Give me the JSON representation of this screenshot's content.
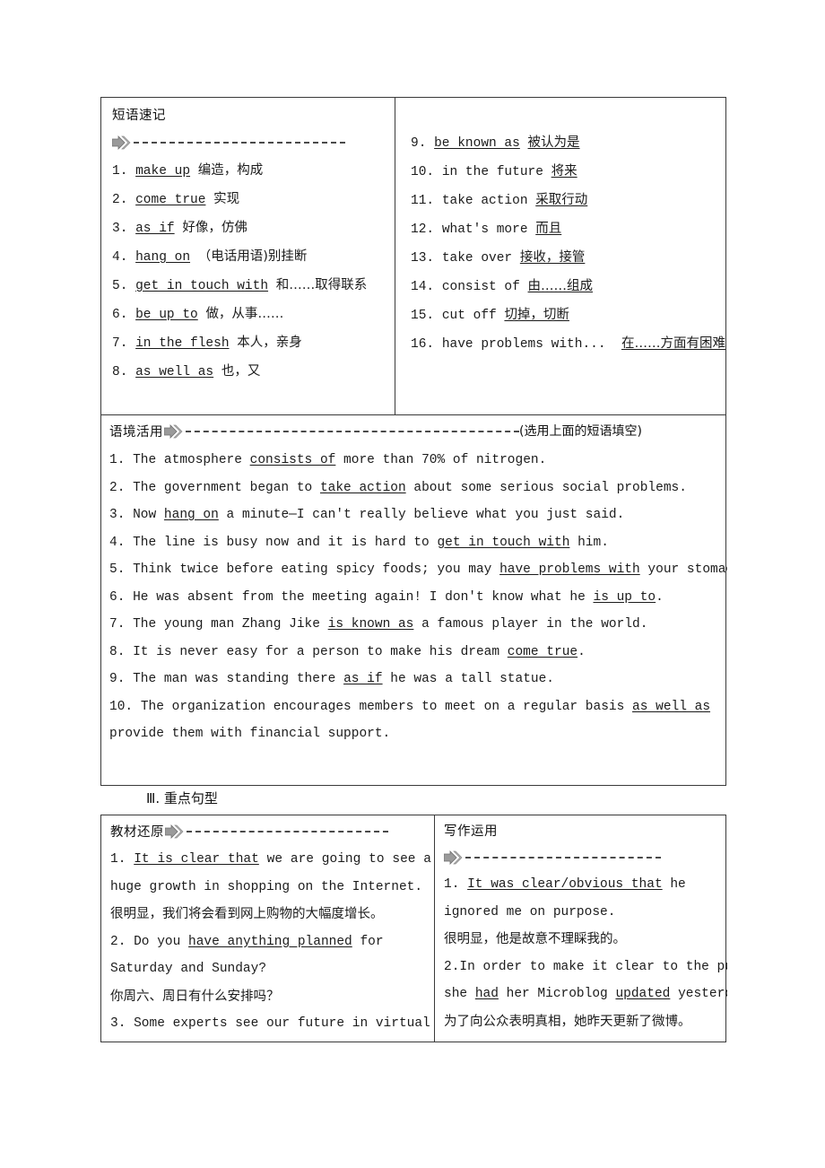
{
  "phrase_box": {
    "title": "短语速记",
    "arrow_icon": "double-chevron-arrow-icon",
    "left_items": [
      {
        "num": "1.",
        "phrase": "make up",
        "meaning": "编造，构成"
      },
      {
        "num": "2.",
        "phrase": "come true",
        "meaning": "实现"
      },
      {
        "num": "3.",
        "phrase": "as if",
        "meaning": "好像，仿佛"
      },
      {
        "num": "4.",
        "phrase": "hang on",
        "meaning": "（电话用语)别挂断"
      },
      {
        "num": "5.",
        "phrase": "get in touch with",
        "meaning": "和……取得联系"
      },
      {
        "num": "6.",
        "phrase": "be up to",
        "meaning": "做，从事……"
      },
      {
        "num": "7.",
        "phrase": "in the flesh",
        "meaning": "本人，亲身"
      },
      {
        "num": "8.",
        "phrase": "as well as",
        "meaning": "也，又"
      }
    ],
    "right_items": [
      {
        "num": "9.",
        "phrase": "be known as",
        "meaning": "被认为是"
      },
      {
        "num": "10.",
        "phrase": "in the future",
        "meaning": "将来"
      },
      {
        "num": "11.",
        "phrase": "take action",
        "meaning": "采取行动"
      },
      {
        "num": "12.",
        "phrase": "what's more",
        "meaning": "而且"
      },
      {
        "num": "13.",
        "phrase": "take over",
        "meaning": "接收，接管"
      },
      {
        "num": "14.",
        "phrase": "consist of",
        "meaning": "由……组成"
      },
      {
        "num": "15.",
        "phrase": "cut off",
        "meaning": "切掉，切断"
      },
      {
        "num": "16.",
        "phrase": "have problems with...",
        "meaning": "在……方面有困难"
      }
    ]
  },
  "context_box": {
    "title": "语境活用",
    "arrow_icon": "double-chevron-arrow-icon",
    "hint": "(选用上面的短语填空)",
    "sentences": [
      {
        "num": "1.",
        "pre": "The atmosphere ",
        "answer": "consists of",
        "post": " more than 70% of nitrogen."
      },
      {
        "num": "2.",
        "pre": "The government began to ",
        "answer": "take action",
        "post": " about some serious social problems."
      },
      {
        "num": "3.",
        "pre": "Now ",
        "answer": "hang on",
        "post": " a minute—I can't really believe what you just said."
      },
      {
        "num": "4.",
        "pre": "The line is busy now and it is hard to ",
        "answer": "get in touch with",
        "post": " him."
      },
      {
        "num": "5.",
        "pre": "Think twice before eating spicy foods; you may ",
        "answer": "have problems with",
        "post": " your stomach."
      },
      {
        "num": "6.",
        "pre": "He was absent from the meeting again! I don't know what he ",
        "answer": "is up to",
        "post": "."
      },
      {
        "num": "7.",
        "pre": "The young man Zhang Jike ",
        "answer": "is known as",
        "post": " a famous player in the world."
      },
      {
        "num": "8.",
        "pre": "It is never easy for a person to make his dream ",
        "answer": "come true",
        "post": "."
      },
      {
        "num": "9.",
        "pre": "The man was standing there ",
        "answer": "as if",
        "post": " he was a tall statue."
      },
      {
        "num": "10.",
        "pre": "The organization encourages members to meet on a regular basis ",
        "answer": "as well as",
        "post": " provide them with financial support."
      }
    ]
  },
  "section_heading": "Ⅲ. 重点句型",
  "sentence_box": {
    "left": {
      "title": "教材还原",
      "arrow_icon": "double-chevron-arrow-icon",
      "entries": [
        {
          "num": "1.",
          "answer": "It is clear that",
          "rest": " we are going to see a huge growth in shopping on the Internet.",
          "translation": "很明显，我们将会看到网上购物的大幅度增长。"
        },
        {
          "num": "2.",
          "pre": "Do you ",
          "answer": "have anything planned",
          "rest": " for Saturday and Sunday?",
          "translation": "你周六、周日有什么安排吗？"
        },
        {
          "num": "3.",
          "pre": "Some experts see our future in virtual",
          "answer": "",
          "rest": "",
          "translation": ""
        }
      ]
    },
    "right": {
      "title": "写作运用",
      "arrow_icon": "double-chevron-arrow-icon",
      "entries": [
        {
          "num": "1.",
          "answer": "It was clear/obvious that",
          "rest": " he ignored me on purpose.",
          "translation": "很明显，他是故意不理睬我的。"
        },
        {
          "num": "2.",
          "pre": "In order to make it clear to the public,",
          "line2_pre": "she ",
          "answer1": "had",
          "line2_mid": " her Microblog ",
          "answer2": "updated",
          "line2_post": " yesterday.",
          "translation": "为了向公众表明真相，她昨天更新了微博。"
        }
      ]
    }
  }
}
